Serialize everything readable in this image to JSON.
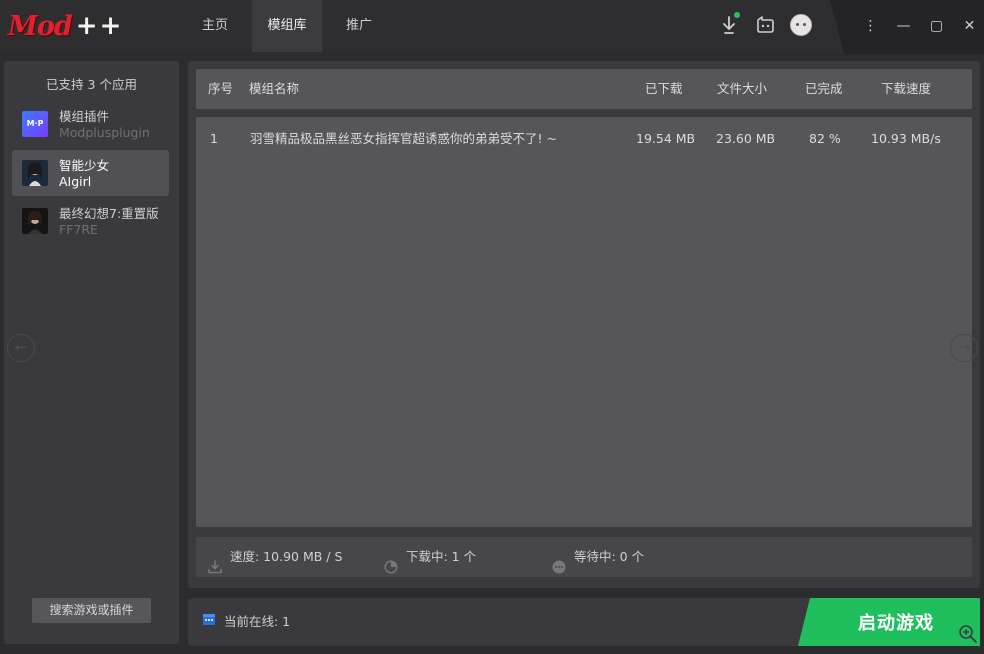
{
  "app": {
    "logo_text": "Mod",
    "logo_plus": "++"
  },
  "nav": {
    "tabs": [
      {
        "label": "主页"
      },
      {
        "label": "模组库"
      },
      {
        "label": "推广"
      }
    ],
    "active_tab": "模组库"
  },
  "toolbar": {
    "icons": [
      "download-icon",
      "chat-icon",
      "avatar"
    ],
    "notification_color": "#22c55e"
  },
  "window_controls": {
    "menu": "⋮",
    "minimize": "—",
    "maximize": "▢",
    "close": "✕"
  },
  "sidebar": {
    "header": "已支持 3 个应用",
    "apps": [
      {
        "name": "模组插件",
        "sub": "Modplusplugin",
        "icon": "mpp-icon"
      },
      {
        "name": "智能少女",
        "sub": "AIgirl",
        "icon": "aigirl-icon"
      },
      {
        "name": "最终幻想7:重置版",
        "sub": "FF7RE",
        "icon": "ff7-icon"
      }
    ],
    "search_button": "搜索游戏或插件"
  },
  "table": {
    "headers": {
      "index": "序号",
      "name": "模组名称",
      "downloaded": "已下载",
      "size": "文件大小",
      "completed": "已完成",
      "speed": "下载速度"
    },
    "rows": [
      {
        "index": "1",
        "name": "羽雪精品极品黑丝恶女指挥官超诱惑你的弟弟受不了! ~",
        "downloaded": "19.54 MB",
        "size": "23.60 MB",
        "completed": "82 %",
        "speed": "10.93 MB/s"
      }
    ]
  },
  "status": {
    "speed": "速度: 10.90 MB / S",
    "downloading": "下载中: 1 个",
    "waiting": "等待中: 0 个"
  },
  "bottom": {
    "online": "当前在线: 1",
    "launch_button": "启动游戏",
    "accent": "#1fbf5e"
  },
  "arrows": {
    "left": "←",
    "right": "→"
  }
}
